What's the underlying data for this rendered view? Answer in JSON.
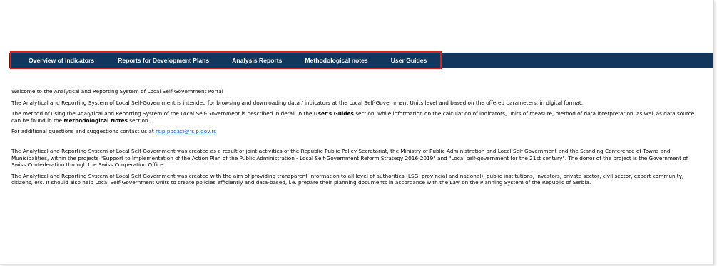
{
  "nav": {
    "items": [
      {
        "label": "Overview of Indicators"
      },
      {
        "label": "Reports for Development Plans"
      },
      {
        "label": "Analysis Reports"
      },
      {
        "label": "Methodological notes"
      },
      {
        "label": "User Guides"
      }
    ]
  },
  "content": {
    "welcome": "Welcome to the Analytical and Reporting System of Local Self-Government Portal",
    "intro": "The Analytical and Reporting System of Local Self-Government is intended for browsing and downloading data / indicators at the Local Self-Government Units level and based on the offered parameters, in digital format.",
    "method_before": "The method of using the Analytical and Reporting System of the Local Self-Government is described in detail in the ",
    "users_guides": "User's Guides",
    "method_middle": " section, while information on the calculation of indicators, units of measure, method of data interpretation, as well as data source can be found in the ",
    "methodological_notes": "Methodological Notes",
    "method_after": " section.",
    "contact_before": "For additional questions and suggestions contact us at ",
    "contact_email": "rsjp.podaci@rsjp.gov.rs",
    "created": "The Analytical and Reporting System of Local Self-Government was created as a result of joint activities of the Republic Public Policy Secretariat, the Ministry of Public Administration and Local Self Government and the Standing Conference of Towns and Municipalities, within the projects \"Support to Implementation of the Action Plan of the Public Administration - Local Self-Government Reform Strategy 2016-2019\" and \"Local self-government for the 21st century\". The donor of the project is the Government of Swiss Confederation through the Swiss Cooperation Office.",
    "aim": "The Analytical and Reporting System of Local Self-Government was created with the aim of providing transparent information to all level of authorities (LSG, provincial and national), public institutions, investors, private sector, civil sector, expert community, citizens, etc. It should also help Local Self-Government Units to create policies efficiently and data-based, i.e. prepare their planning documents in accordance with the Law on the Planning System of the Republic of Serbia."
  },
  "colors": {
    "navbar": "#12375f",
    "highlight": "#e0201b",
    "link": "#1a4fd8"
  }
}
